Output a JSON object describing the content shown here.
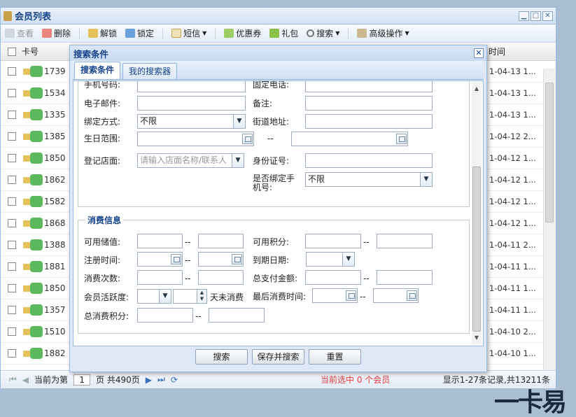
{
  "window": {
    "title": "会员列表",
    "ctrl_min": "▁",
    "ctrl_max": "□",
    "ctrl_close": "✕"
  },
  "toolbar": {
    "view": "查看",
    "delete": "删除",
    "unlock": "解锁",
    "lock": "锁定",
    "sms": "短信",
    "coupon": "优惠券",
    "gift": "礼包",
    "search": "搜索",
    "advanced": "高级操作"
  },
  "grid": {
    "header_card": "卡号",
    "header_time": "时间",
    "rows": [
      {
        "card": "1739",
        "time": "1-04-13 1..."
      },
      {
        "card": "1534",
        "time": "1-04-13 1..."
      },
      {
        "card": "1335",
        "time": "1-04-13 1..."
      },
      {
        "card": "1385",
        "time": "1-04-12 2..."
      },
      {
        "card": "1850",
        "time": "1-04-12 1..."
      },
      {
        "card": "1862",
        "time": "1-04-12 1..."
      },
      {
        "card": "1582",
        "time": "1-04-12 1..."
      },
      {
        "card": "1868",
        "time": "1-04-12 1..."
      },
      {
        "card": "1388",
        "time": "1-04-11 2..."
      },
      {
        "card": "1881",
        "time": "1-04-11 1..."
      },
      {
        "card": "1850",
        "time": "1-04-11 1..."
      },
      {
        "card": "1357",
        "time": "1-04-11 1..."
      },
      {
        "card": "1510",
        "time": "1-04-10 2..."
      },
      {
        "card": "1882",
        "time": "1-04-10 1..."
      }
    ]
  },
  "pager": {
    "current_prefix": "当前为第",
    "page": "1",
    "page_suffix": "页 共490页",
    "selected": "当前选中 0 个会员",
    "total": "显示1-27条记录,共13211条"
  },
  "logo": "一卡易",
  "modal": {
    "title": "搜索条件",
    "close": "✕",
    "tabs": [
      "搜索条件",
      "我的搜索器"
    ],
    "section1": {
      "phone_label": "手机号码:",
      "fixed_phone_label": "固定电话:",
      "email_label": "电子邮件:",
      "remark_label": "备注:",
      "bind_label": "绑定方式:",
      "bind_value": "不限",
      "address_label": "街道地址:",
      "birthday_label": "生日范围:",
      "range_sep": "--",
      "store_label": "登记店面:",
      "store_placeholder": "请输入店面名称/联系人",
      "idcard_label": "身份证号:",
      "bindphone_label_1": "是否绑定手",
      "bindphone_label_2": "机号:",
      "bindphone_value": "不限"
    },
    "section2": {
      "legend": "消费信息",
      "balance_label": "可用储值:",
      "points_label": "可用积分:",
      "regtime_label": "注册时间:",
      "expire_label": "到期日期:",
      "count_label": "消费次数:",
      "total_pay_label": "总支付金额:",
      "activity_label": "会员活跃度:",
      "activity_suffix": "天未消费",
      "last_time_label": "最后消费时间:",
      "total_points_label": "总消费积分:",
      "sep": "--"
    },
    "buttons": {
      "search": "搜索",
      "save_search": "保存并搜索",
      "reset": "重置"
    }
  },
  "icons": {
    "wechat": "wechat-icon",
    "lock": "lock-icon"
  }
}
